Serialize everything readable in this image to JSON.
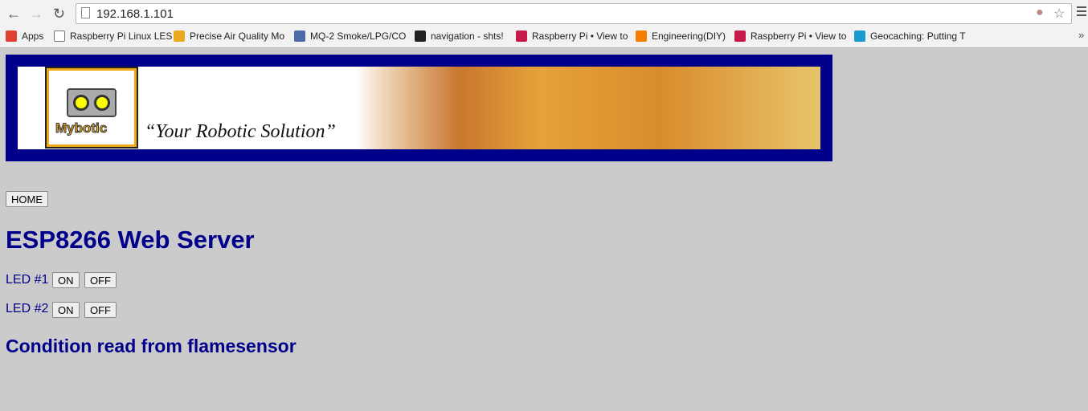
{
  "browser": {
    "url": "192.168.1.101",
    "bookmarks": [
      {
        "label": "Apps",
        "icon": "apps-grid-icon",
        "color": "#e04030"
      },
      {
        "label": "Raspberry Pi Linux LES",
        "icon": "page-icon",
        "color": "#ffffff"
      },
      {
        "label": "Precise Air Quality Mo",
        "icon": "robot-favicon-icon",
        "color": "#e8a820"
      },
      {
        "label": "MQ-2 Smoke/LPG/CO",
        "icon": "s-favicon-icon",
        "color": "#4a6aa8"
      },
      {
        "label": "navigation - shts!",
        "icon": "square-favicon-icon",
        "color": "#222222"
      },
      {
        "label": "Raspberry Pi • View to",
        "icon": "raspberry-icon",
        "color": "#c51a4a"
      },
      {
        "label": "Engineering(DIY)",
        "icon": "blogger-icon",
        "color": "#f57d00"
      },
      {
        "label": "Raspberry Pi • View to",
        "icon": "raspberry-icon",
        "color": "#c51a4a"
      },
      {
        "label": "Geocaching: Putting T",
        "icon": "e14-favicon-icon",
        "color": "#1a9bd0"
      }
    ]
  },
  "banner": {
    "logo_text": "Mybotic",
    "tagline": "“Your Robotic Solution”"
  },
  "page": {
    "home": "HOME",
    "title": "ESP8266 Web Server",
    "leds": [
      {
        "label": "LED #1",
        "on": "ON",
        "off": "OFF"
      },
      {
        "label": "LED #2",
        "on": "ON",
        "off": "OFF"
      }
    ],
    "condition": "Condition read from flamesensor"
  },
  "colors": {
    "heading": "#00008b",
    "background": "#cbcbcb"
  }
}
